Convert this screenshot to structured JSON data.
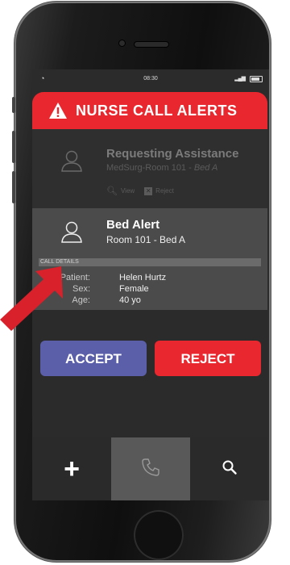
{
  "status_bar": {
    "time": "08:30"
  },
  "header": {
    "title": "NURSE CALL ALERTS"
  },
  "alerts": [
    {
      "title": "Requesting Assistance",
      "location": "MedSurg-Room 101 - ",
      "location_suffix": "Bed A",
      "view_label": "View",
      "reject_label": "Reject"
    },
    {
      "title": "Bed Alert",
      "location": "Room 101 - Bed A",
      "details_label": "CALL DETAILS",
      "fields": [
        {
          "label": "Patient:",
          "value": "Helen Hurtz"
        },
        {
          "label": "Sex:",
          "value": "Female"
        },
        {
          "label": "Age:",
          "value": "40 yo"
        }
      ]
    }
  ],
  "buttons": {
    "accept": "ACCEPT",
    "reject": "REJECT"
  },
  "tabbar": {
    "add_icon": "+"
  },
  "colors": {
    "alert_red": "#e8272e",
    "accept_blue": "#5b5fa9",
    "screen_bg": "#2b2b2b",
    "selected_row": "#4b4b4b"
  },
  "icons": [
    "warning-icon",
    "user-icon",
    "view-icon",
    "reject-box-icon",
    "plus-icon",
    "phone-icon",
    "search-icon",
    "arrow-pointer-icon"
  ]
}
